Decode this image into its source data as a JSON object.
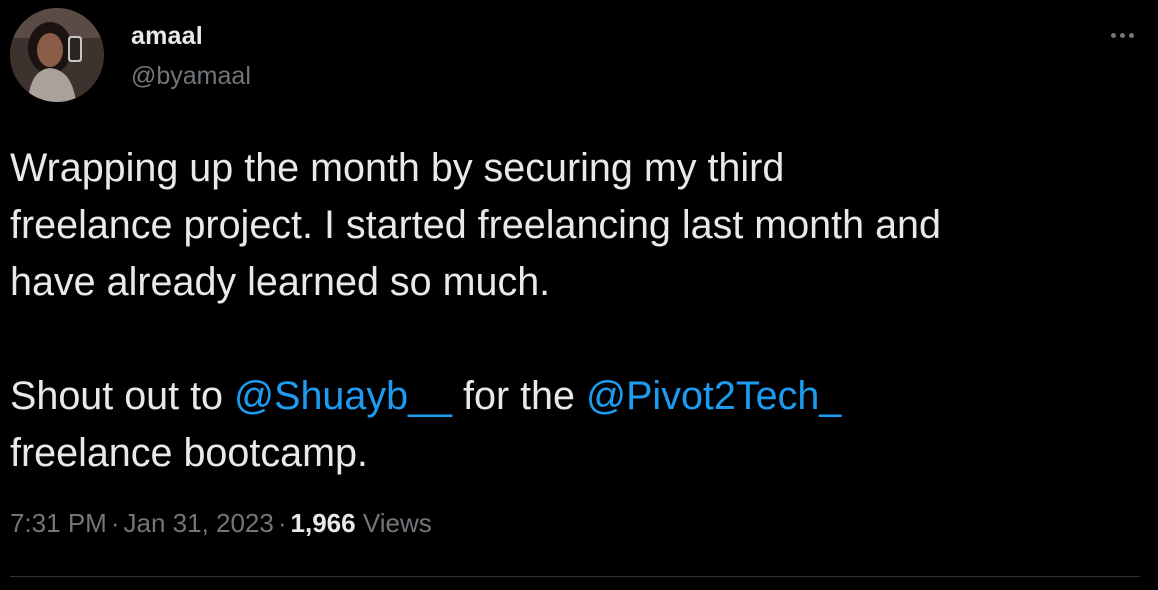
{
  "author": {
    "display_name": "amaal",
    "handle": "@byamaal"
  },
  "tweet": {
    "line1_prefix": "Wrapping up the month by securing my third",
    "line2": "freelance project. I started freelancing last month and",
    "line3": "have already learned so much.",
    "shout_prefix": "Shout out to ",
    "mention1": "@Shuayb__",
    "shout_middle": " for the ",
    "mention2": "@Pivot2Tech_",
    "shout_suffix": "freelance bootcamp."
  },
  "meta": {
    "time": "7:31 PM",
    "separator": "·",
    "date": "Jan 31, 2023",
    "views_count": "1,966",
    "views_label": "Views"
  },
  "icons": {
    "more": "more-horizontal-icon"
  },
  "colors": {
    "background": "#000000",
    "text": "#e7e9ea",
    "secondary": "#71767b",
    "link": "#1d9bf0",
    "divider": "#2f3336"
  }
}
